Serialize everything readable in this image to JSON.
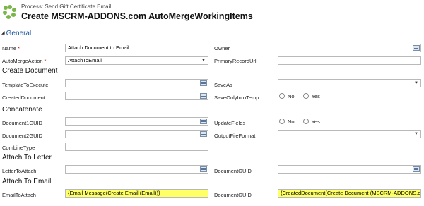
{
  "header": {
    "process_line": "Process: Send Gift Certificate Email",
    "title": "Create MSCRM-ADDONS.com AutoMergeWorkingItems"
  },
  "section": {
    "label": "General"
  },
  "groups": {
    "create_document": "Create Document",
    "concatenate": "Concatenate",
    "attach_to_letter": "Attach To Letter",
    "attach_to_email": "Attach To Email"
  },
  "labels": {
    "name": "Name",
    "owner": "Owner",
    "automergeaction": "AutoMergeAction",
    "primaryrecordurl": "PrimaryRecordUrl",
    "templatetoexecute": "TemplateToExecute",
    "saveas": "SaveAs",
    "createddocument": "CreatedDocument",
    "saveonlyintotemp": "SaveOnlyIntoTemp",
    "document1guid": "Document1GUID",
    "updatefields": "UpdateFields",
    "document2guid": "Document2GUID",
    "outputfileformat": "OutputFileFormat",
    "combinetype": "CombineType",
    "lettertoattach": "LetterToAttach",
    "documentguid_1": "DocumentGUID",
    "emailtoattach": "EmailToAttach",
    "documentguid_2": "DocumentGUID"
  },
  "required_marker": "*",
  "values": {
    "name": "Attach Document to Email",
    "automergeaction": "AttachToEmail",
    "emailtoattach": "{Email Message(Create Email (Email))}",
    "documentguid_2": "{CreatedDocument(Create Document (MSCRM-ADDONS.com AutoMergeWorkingItems))}"
  },
  "radio": {
    "no": "No",
    "yes": "Yes"
  },
  "colors": {
    "highlight": "#ffff66",
    "section_link": "#1f58a0",
    "required": "#c00000"
  }
}
